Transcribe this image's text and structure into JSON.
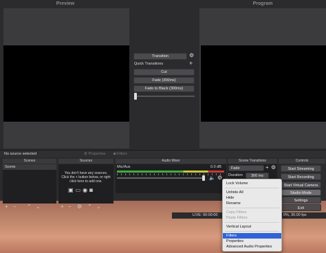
{
  "preview": {
    "title": "Preview"
  },
  "program": {
    "title": "Program"
  },
  "transitions_panel": {
    "transition_button": "Transition",
    "quick_transitions_label": "Quick Transitions",
    "items": [
      "Cut",
      "Fade (300ms)",
      "Fade to Black (300ms)"
    ]
  },
  "source_bar": {
    "status": "No source selected",
    "properties": "Properties",
    "filters": "Filters"
  },
  "docks": {
    "scenes": {
      "title": "Scenes",
      "items": [
        "Scene"
      ]
    },
    "sources": {
      "title": "Sources",
      "empty_text": "You don't have any sources. Click the + button below, or right click here to add one."
    },
    "audio_mixer": {
      "title": "Audio Mixer",
      "track_name": "Mic/Aux",
      "db": "0.0 dB"
    },
    "scene_transitions": {
      "title": "Scene Transitions",
      "selected": "Fade",
      "duration_label": "Duration",
      "duration_value": "300 ms"
    },
    "controls": {
      "title": "Controls",
      "buttons": [
        "Start Streaming",
        "Start Recording",
        "Start Virtual Camera",
        "Studio Mode",
        "Settings",
        "Exit"
      ]
    }
  },
  "status_bar": {
    "live": "LIVE: 00:00:00",
    "fps": "0%, 30.00 fps"
  },
  "context_menu": {
    "items": [
      "Lock Volume",
      "Unhide All",
      "Hide",
      "Rename",
      "Copy Filters",
      "Paste Filters",
      "Vertical Layout",
      "Filters",
      "Properties",
      "Advanced Audio Properties"
    ],
    "highlighted": "Filters"
  },
  "colors": {
    "accent": "#2f63d6",
    "meter_green": "#3fae3f",
    "meter_yellow": "#c8c83a",
    "meter_red": "#c83a3a"
  }
}
